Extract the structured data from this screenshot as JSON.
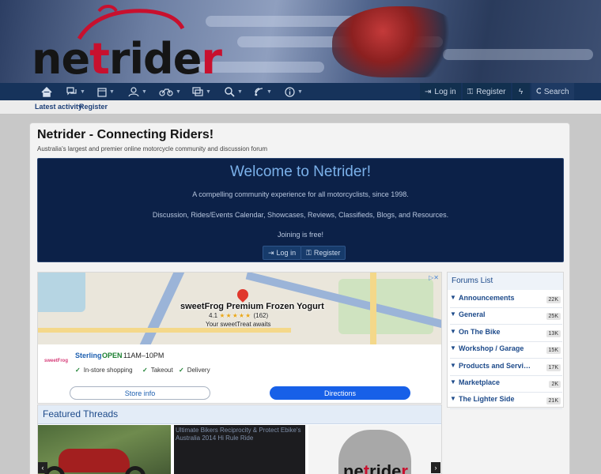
{
  "header": {
    "logo_text_1": "ne",
    "logo_text_2": "t",
    "logo_text_3": "ride",
    "logo_text_4": "r",
    "brand_red": "#c8102e",
    "nav_icons": [
      "home-icon",
      "forums-icon",
      "calendar-icon",
      "members-icon",
      "bike-icon",
      "showcase-icon",
      "search-icon",
      "links-icon",
      "info-icon"
    ],
    "login_label": "Log in",
    "register_label": "Register",
    "search_label": "Search"
  },
  "subnav": {
    "latest_activity": "Latest activity",
    "register": "Register"
  },
  "page": {
    "title": "Netrider - Connecting Riders!",
    "subtitle": "Australia's largest and premier online motorcycle community and discussion forum"
  },
  "welcome": {
    "heading": "Welcome to Netrider!",
    "line1": "A compelling community experience for all motorcyclists, since 1998.",
    "line2": "Discussion, Rides/Events Calendar, Showcases, Reviews, Classifieds, Blogs, and Resources.",
    "line3": "Joining is free!",
    "login_button": "Log in",
    "register_button": "Register"
  },
  "ad": {
    "map_title": "sweetFrog Premium Frozen Yogurt",
    "rating": "4.1",
    "stars": "★★★★★",
    "review_count": "(162)",
    "tagline": "Your sweetTreat awaits",
    "logo_text": "sweetFrog",
    "store_name": "Sterling",
    "open_status": "OPEN",
    "hours": "11AM–10PM",
    "features": [
      "In-store shopping",
      "Takeout",
      "Delivery"
    ],
    "store_info_button": "Store info",
    "directions_button": "Directions"
  },
  "featured": {
    "heading": "Featured Threads",
    "broken_image_alt": "Ultimate Bikers Reciprocity & Protect Ebike's Australia 2014 Hi Rule Ride"
  },
  "forums": {
    "heading": "Forums List",
    "items": [
      {
        "label": "Announcements",
        "count": "22K"
      },
      {
        "label": "General",
        "count": "25K"
      },
      {
        "label": "On The Bike",
        "count": "13K"
      },
      {
        "label": "Workshop / Garage",
        "count": "15K"
      },
      {
        "label": "Products and Services",
        "count": "17K"
      },
      {
        "label": "Marketplace",
        "count": "2K"
      },
      {
        "label": "The Lighter Side",
        "count": "21K"
      }
    ]
  }
}
